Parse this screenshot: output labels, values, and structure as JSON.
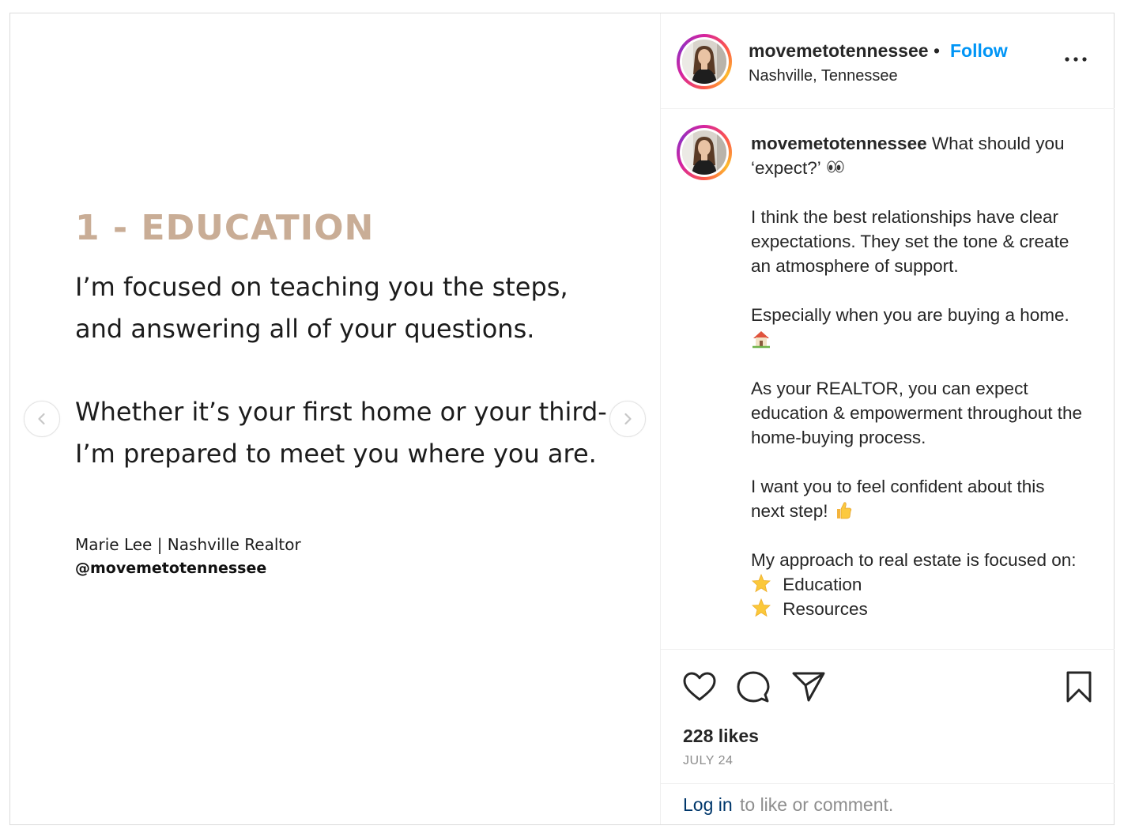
{
  "slide": {
    "title": "1 - EDUCATION",
    "title_color": "#c9ad96",
    "paragraph1": "I’m focused on teaching you the steps, and answering all of your questions.",
    "paragraph2": "Whether it’s your first home or your third- I’m prepared to meet you where you are.",
    "signature": "Marie Lee | Nashville Realtor",
    "handle": "@movemetotennessee"
  },
  "header": {
    "username": "movemetotennessee",
    "separator": "•",
    "follow_label": "Follow",
    "location": "Nashville, Tennessee"
  },
  "caption": {
    "username": "movemetotennessee",
    "line1": "What should you ‘expect?’",
    "para2": "I think the best relationships have clear expectations. They set the tone & create an atmosphere of support.",
    "para3": "Especially when you are buying a home.",
    "para4": "As your REALTOR, you can expect education & empowerment throughout the home-buying process.",
    "para5": "I want you to feel confident about this next step!",
    "para6": "My approach to real estate is focused on:",
    "list": [
      "Education",
      "Resources"
    ]
  },
  "actions": {
    "likes": "228 likes",
    "date": "JULY 24"
  },
  "login": {
    "link": "Log in",
    "rest": "to like or comment."
  },
  "colors": {
    "follow": "#0095f6",
    "accent_text": "#c9ad96",
    "muted": "#8e8e8e"
  },
  "icons": [
    "chevron-left-icon",
    "chevron-right-icon",
    "more-options-icon",
    "heart-icon",
    "comment-icon",
    "share-icon",
    "bookmark-icon",
    "eyes-emoji",
    "house-emoji",
    "thumbs-up-emoji",
    "star-emoji"
  ]
}
